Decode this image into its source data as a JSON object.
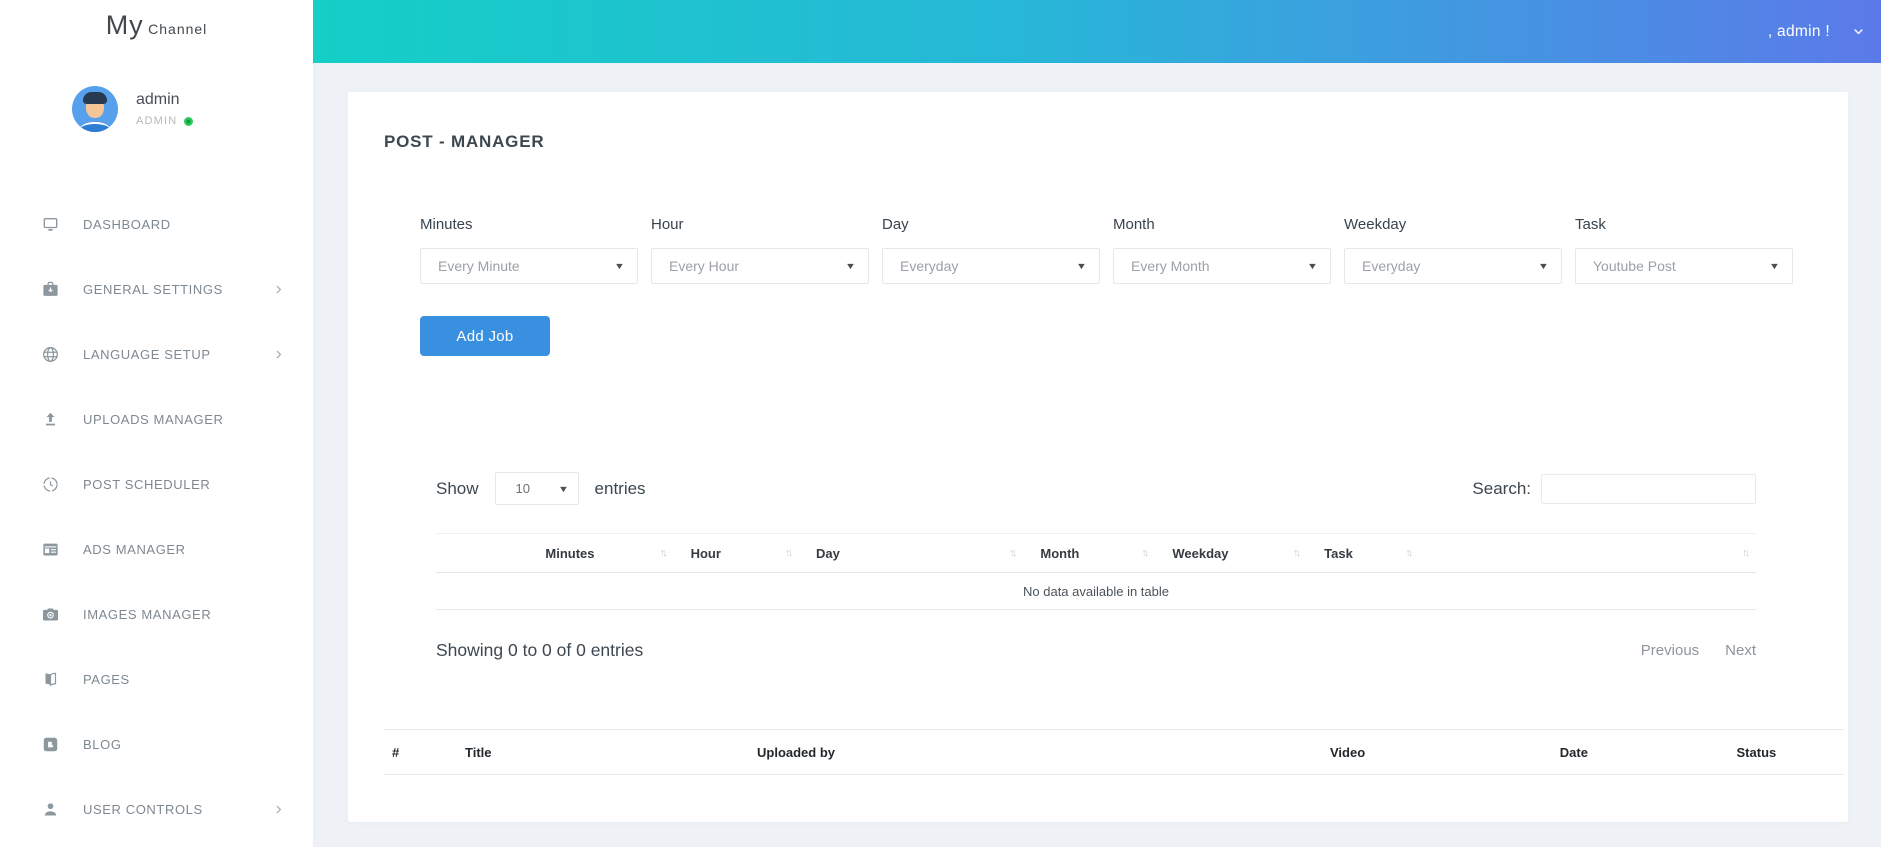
{
  "colors": {
    "header_gradient_from": "#14cfc6",
    "header_gradient_to": "#5b7ae9",
    "primary_button": "#3a90e0",
    "status_online": "#2ecc5e",
    "sidebar_icon": "#8d979e"
  },
  "icons": {
    "caret_down": "▼",
    "sort_up": "↑",
    "sort_down": "↓"
  },
  "sidebar": {
    "logo": {
      "primary": "My",
      "secondary": "Channel"
    },
    "profile": {
      "name": "admin",
      "role": "ADMIN"
    },
    "nav": [
      {
        "label": "DASHBOARD"
      },
      {
        "label": "GENERAL SETTINGS"
      },
      {
        "label": "LANGUAGE SETUP"
      },
      {
        "label": "UPLOADS MANAGER"
      },
      {
        "label": "POST SCHEDULER"
      },
      {
        "label": "ADS MANAGER"
      },
      {
        "label": "IMAGES MANAGER"
      },
      {
        "label": "PAGES"
      },
      {
        "label": "BLOG"
      },
      {
        "label": "USER CONTROLS"
      }
    ]
  },
  "header": {
    "user_greeting": ", admin !"
  },
  "page": {
    "title": "POST - MANAGER"
  },
  "scheduler_form": {
    "fields": [
      {
        "label": "Minutes",
        "value": "Every Minute"
      },
      {
        "label": "Hour",
        "value": "Every Hour"
      },
      {
        "label": "Day",
        "value": "Everyday"
      },
      {
        "label": "Month",
        "value": "Every Month"
      },
      {
        "label": "Weekday",
        "value": "Everyday"
      },
      {
        "label": "Task",
        "value": "Youtube Post"
      }
    ],
    "add_button_label": "Add Job"
  },
  "jobs_table": {
    "show_label": "Show",
    "page_length": "10",
    "entries_label": "entries",
    "search_label": "Search:",
    "search_value": "",
    "columns": [
      "",
      "Minutes",
      "Hour",
      "Day",
      "Month",
      "Weekday",
      "Task",
      ""
    ],
    "empty_message": "No data available in table",
    "info": "Showing 0 to 0 of 0 entries",
    "pagination": {
      "previous": "Previous",
      "next": "Next"
    }
  },
  "videos_table": {
    "columns": [
      "#",
      "Title",
      "Uploaded by",
      "Video",
      "Date",
      "Status"
    ]
  }
}
